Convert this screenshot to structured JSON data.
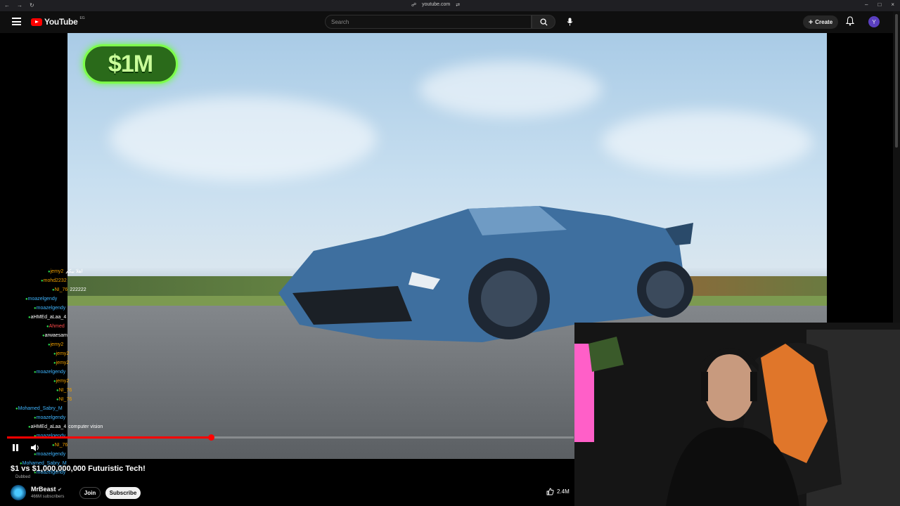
{
  "browser": {
    "url": "youtube.com"
  },
  "header": {
    "logo_text": "YouTube",
    "logo_country": "EG",
    "search_placeholder": "Search",
    "create_label": "Create",
    "avatar_letter": "Y"
  },
  "player": {
    "overlay_badge": "$1M",
    "progress_fraction": 0.36
  },
  "chat": {
    "messages": [
      {
        "user": "jemy2",
        "text": "اهلا بيكم",
        "user_color": "orange"
      },
      {
        "user": "mohd2232",
        "text": "",
        "user_color": "orange"
      },
      {
        "user": "NI_76",
        "text": "222222",
        "user_color": "orange"
      },
      {
        "user": "moazelgendy",
        "text": "",
        "user_color": "blue"
      },
      {
        "user": "moazelgendy",
        "text": "",
        "user_color": "blue"
      },
      {
        "user": "aHMEd_aLaa_4",
        "text": "",
        "user_color": "white"
      },
      {
        "user": "Ahmed",
        "text": "",
        "user_color": "red"
      },
      {
        "user": "arwaesam",
        "text": "",
        "user_color": "white"
      },
      {
        "user": "jemy2",
        "text": "",
        "user_color": "orange"
      },
      {
        "user": "jemy2",
        "text": "",
        "user_color": "orange"
      },
      {
        "user": "jemy2",
        "text": "",
        "user_color": "orange"
      },
      {
        "user": "moazelgendy",
        "text": "",
        "user_color": "blue"
      },
      {
        "user": "jemy2",
        "text": "",
        "user_color": "orange"
      },
      {
        "user": "NI_76",
        "text": "",
        "user_color": "orange"
      },
      {
        "user": "NI_76",
        "text": "",
        "user_color": "orange"
      },
      {
        "user": "Mohamed_Sabry_M",
        "text": "",
        "user_color": "blue"
      },
      {
        "user": "moazelgendy",
        "text": "",
        "user_color": "blue"
      },
      {
        "user": "aHMEd_aLaa_4",
        "text": "computer vision",
        "user_color": "white"
      },
      {
        "user": "moazelgendy",
        "text": "",
        "user_color": "blue"
      },
      {
        "user": "NI_76",
        "text": "",
        "user_color": "orange"
      },
      {
        "user": "moazelgendy",
        "text": "",
        "user_color": "blue"
      },
      {
        "user": "Mohamed_Sabry_M",
        "text": "",
        "user_color": "blue"
      },
      {
        "user": "moazelgendy",
        "text": "",
        "user_color": "blue"
      }
    ]
  },
  "video": {
    "title": "$1 vs $1,000,000,000 Futuristic Tech!",
    "dubbed": "Dubbed",
    "channel": "MrBeast",
    "subscribers": "466M subscribers",
    "join_label": "Join",
    "subscribe_label": "Subscribe",
    "likes": "2.4M"
  }
}
